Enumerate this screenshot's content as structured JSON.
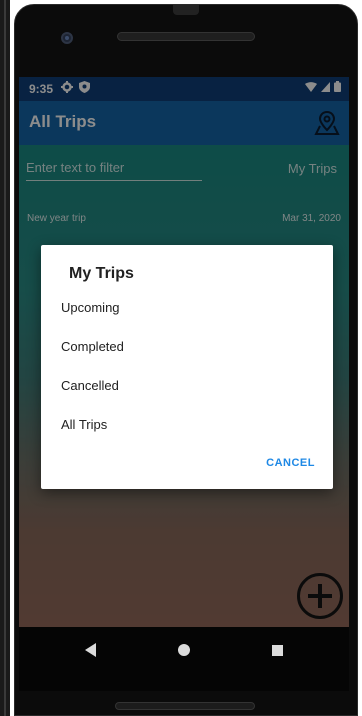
{
  "status_bar": {
    "time": "9:35",
    "left_icons": [
      "gear-icon",
      "shield-icon"
    ],
    "right_icons": [
      "wifi-icon",
      "signal-icon",
      "battery-icon"
    ]
  },
  "app_bar": {
    "title": "All Trips",
    "map_icon": "map-pin-icon"
  },
  "filter": {
    "placeholder": "Enter text to filter",
    "mode_label": "My Trips"
  },
  "trips": [
    {
      "name": "New year trip",
      "date": "Mar 31, 2020"
    }
  ],
  "dialog": {
    "title": "My Trips",
    "options": [
      "Upcoming",
      "Completed",
      "Cancelled",
      "All Trips"
    ],
    "cancel_label": "CANCEL"
  },
  "fab": {
    "icon": "plus-circle-icon"
  },
  "nav": {
    "icons": [
      "back-icon",
      "home-icon",
      "recents-icon"
    ]
  },
  "colors": {
    "status_bar": "#0f3f79",
    "app_bar": "#1565a8",
    "accent": "#1e88e5"
  }
}
